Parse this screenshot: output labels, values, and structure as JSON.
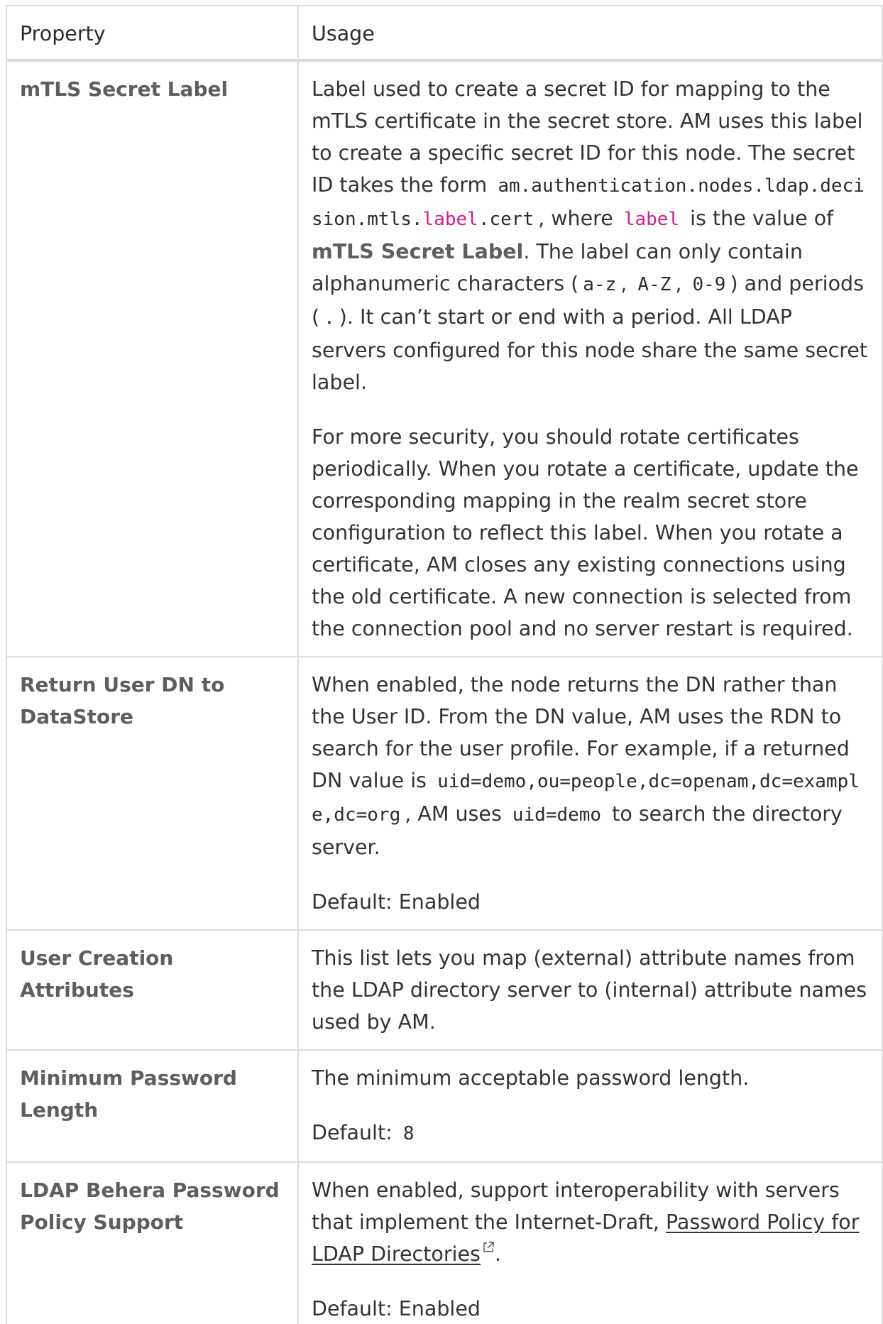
{
  "table": {
    "headers": [
      "Property",
      "Usage"
    ],
    "rows": {
      "mtls": {
        "property": "mTLS Secret Label",
        "p1_a": "Label used to create a secret ID for mapping to the mTLS certificate in the secret store. AM uses this label to create a specific secret ID for this node. The secret ID takes the form",
        "code1_prefix": "am.authentication.nodes.ldap.decision.mtls.",
        "code1_var": "label",
        "code1_suffix": ".cert",
        "p1_b": ", where",
        "code2": "label",
        "p1_c": "is the value of",
        "bold1": "mTLS Secret Label",
        "p1_d": ". The label can only contain alphanumeric characters (",
        "code3": "a-z",
        "comma1": ",",
        "code4": "A-Z",
        "comma2": ",",
        "code5": "0-9",
        "p1_e": ") and periods (",
        "code6": ".",
        "p1_f": "). It can’t start or end with a period. All LDAP servers configured for this node share the same secret label.",
        "p2": "For more security, you should rotate certificates periodically. When you rotate a certificate, update the corresponding mapping in the realm secret store configuration to reflect this label. When you rotate a certificate, AM closes any existing connections using the old certificate. A new connection is selected from the connection pool and no server restart is required."
      },
      "return_dn": {
        "property": "Return User DN to DataStore",
        "p1_a": "When enabled, the node returns the DN rather than the User ID. From the DN value, AM uses the RDN to search for the user profile. For example, if a returned DN value is",
        "code1": "uid=demo,ou=people,dc=openam,dc=example,dc=org",
        "p1_b": ", AM uses",
        "code2": "uid=demo",
        "p1_c": "to search the directory server.",
        "default": "Default: Enabled"
      },
      "user_creation": {
        "property": "User Creation Attributes",
        "p1": "This list lets you map (external) attribute names from the LDAP directory server to (internal) attribute names used by AM."
      },
      "min_password": {
        "property": "Minimum Password Length",
        "p1": "The minimum acceptable password length.",
        "default_label": "Default:",
        "default_value": "8"
      },
      "behera": {
        "property": "LDAP Behera Password Policy Support",
        "p1_a": "When enabled, support interoperability with servers that implement the Internet-Draft,",
        "link": "Password Policy for LDAP Directories",
        "link_icon": "external-link-icon",
        "p1_b": ".",
        "default": "Default: Enabled"
      }
    }
  }
}
